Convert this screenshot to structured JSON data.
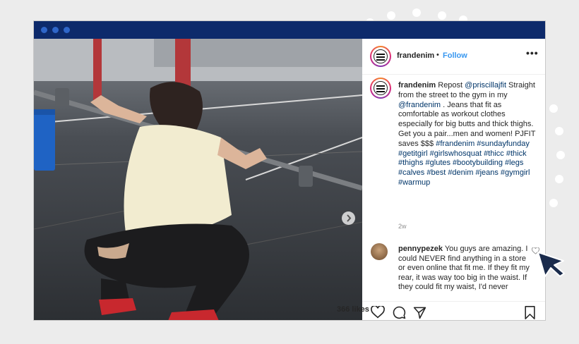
{
  "post": {
    "username": "frandenim",
    "separator": "•",
    "follow_label": "Follow",
    "more_label": "•••",
    "caption": {
      "username": "frandenim",
      "prefix": " Repost ",
      "mention1": "@priscillajfit",
      "text1": " Straight from the street to the gym in my ",
      "mention2": "@frandenim",
      "text2": " . Jeans that fit as comfortable as workout clothes especially for big butts and thick thighs. Get you a pair...men and women! PJFIT saves $$$ ",
      "hashtags": "#frandenim #sundayfunday #getitgirl #girlswhosquat #thicc #thick #thighs #glutes #bootybuilding #legs #calves #best #denim #jeans #gymgirl #warmup"
    },
    "time_ago": "2w",
    "comment": {
      "username": "pennypezek",
      "text": " You guys are amazing. I could NEVER find anything in a store or even online that fit me. If they fit my rear, it was way too big in the waist. If they could fit my waist, I'd never"
    },
    "likes": "366 likes"
  },
  "icons": {
    "next": "chevron-right-icon",
    "like": "heart-icon",
    "comment": "comment-icon",
    "share": "paper-plane-icon",
    "save": "bookmark-icon"
  },
  "colors": {
    "titlebar": "#0d2a6b",
    "follow": "#3897f0",
    "link": "#003569",
    "cursor": "#1a2b4c"
  }
}
